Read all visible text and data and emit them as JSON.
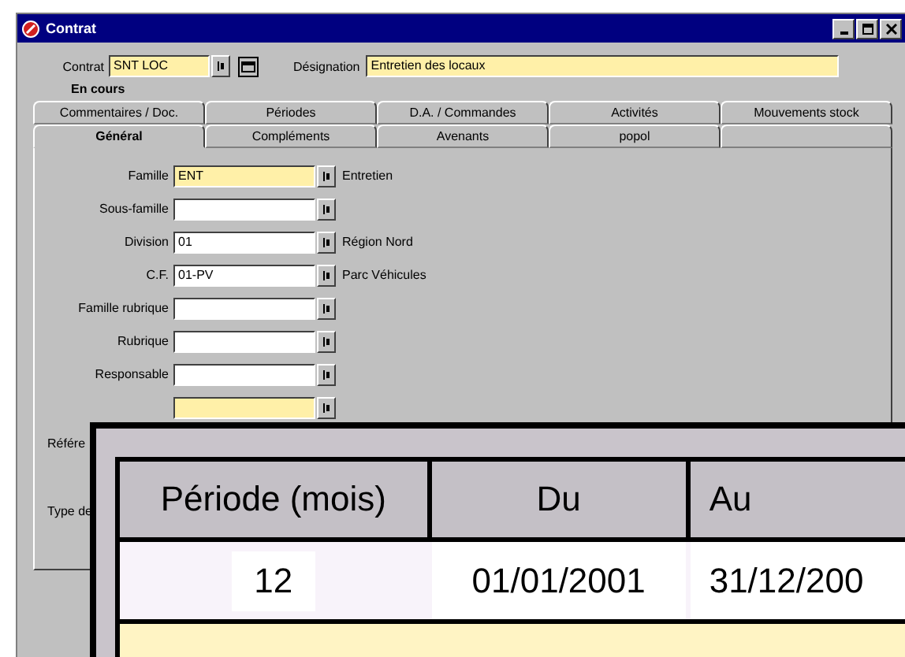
{
  "window": {
    "title": "Contrat"
  },
  "header": {
    "contract_label": "Contrat",
    "contract_value": "SNT LOC",
    "contract_required": true,
    "designation_label": "Désignation",
    "designation_value": "Entretien des locaux",
    "designation_required": true,
    "status": "En cours"
  },
  "tabs_row_1": [
    {
      "label": "Commentaires / Doc.",
      "selected": false
    },
    {
      "label": "Périodes",
      "selected": false
    },
    {
      "label": "D.A. / Commandes",
      "selected": false
    },
    {
      "label": "Activités",
      "selected": false
    },
    {
      "label": "Mouvements stock",
      "selected": false
    }
  ],
  "tabs_row_2": [
    {
      "label": "Général",
      "selected": true
    },
    {
      "label": "Compléments",
      "selected": false
    },
    {
      "label": "Avenants",
      "selected": false
    },
    {
      "label": "popol",
      "selected": false
    },
    {
      "selected": false
    }
  ],
  "fields": [
    {
      "label": "Famille",
      "value": "ENT",
      "required": true,
      "description": "Entretien"
    },
    {
      "label": "Sous-famille",
      "required": false
    },
    {
      "label": "Division",
      "value": "01",
      "required": false,
      "description": "Région Nord"
    },
    {
      "label": "C.F.",
      "value": "01-PV",
      "required": false,
      "description": "Parc Véhicules"
    },
    {
      "label": "Famille rubrique",
      "required": false
    },
    {
      "label": "Rubrique",
      "required": false
    },
    {
      "label": "Responsable",
      "required": false
    },
    {
      "required": true
    }
  ],
  "hidden_labels": [
    "Référe",
    "Type de"
  ],
  "zoom_table": {
    "columns": [
      "Période (mois)",
      "Du",
      "Au"
    ],
    "rows": [
      {
        "cells": [
          "12",
          "01/01/2001",
          "31/12/200"
        ],
        "selected": false
      },
      {
        "selected": true
      }
    ]
  }
}
